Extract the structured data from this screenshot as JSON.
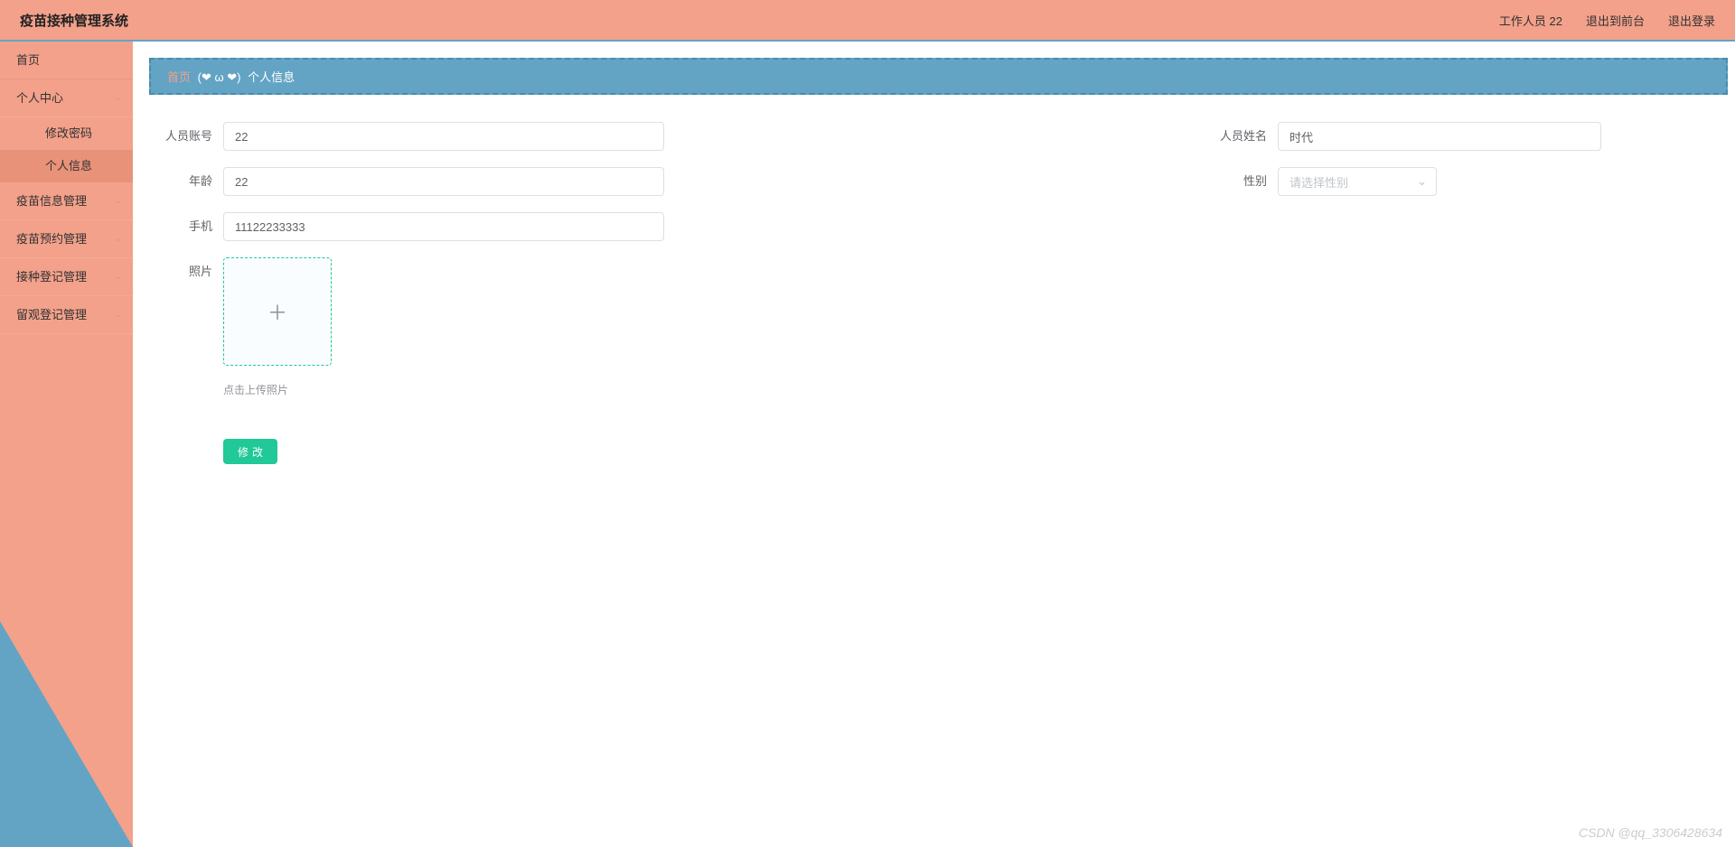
{
  "app_title": "疫苗接种管理系统",
  "header": {
    "user": "工作人员 22",
    "front": "退出到前台",
    "logout": "退出登录"
  },
  "sidebar": {
    "home": "首页",
    "personal": "个人中心",
    "sub_pwd": "修改密码",
    "sub_info": "个人信息",
    "vaccine_info": "疫苗信息管理",
    "vaccine_appt": "疫苗预约管理",
    "inoc_reg": "接种登记管理",
    "obs_reg": "留观登记管理"
  },
  "breadcrumb": {
    "home": "首页",
    "sep": "(❤ ω ❤)",
    "current": "个人信息"
  },
  "form": {
    "account_label": "人员账号",
    "account_val": "22",
    "name_label": "人员姓名",
    "name_val": "时代",
    "age_label": "年龄",
    "age_val": "22",
    "gender_label": "性别",
    "gender_placeholder": "请选择性别",
    "phone_label": "手机",
    "phone_val": "11122233333",
    "photo_label": "照片",
    "photo_hint": "点击上传照片",
    "submit": "修改"
  },
  "watermark": "CSDN @qq_3306428634"
}
